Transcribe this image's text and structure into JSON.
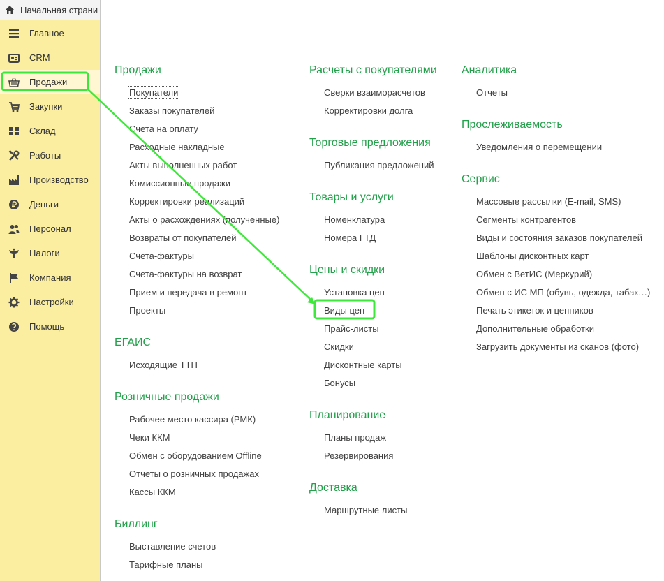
{
  "tab": {
    "title": "Начальная страни",
    "icon": "home-icon"
  },
  "sidebar": {
    "items": [
      {
        "label": "Главное",
        "icon": "menu-lines-icon"
      },
      {
        "label": "CRM",
        "icon": "address-card-icon"
      },
      {
        "label": "Продажи",
        "icon": "shopping-basket-icon"
      },
      {
        "label": "Закупки",
        "icon": "cart-icon"
      },
      {
        "label": "Склад",
        "icon": "warehouse-grid-icon"
      },
      {
        "label": "Работы",
        "icon": "tools-icon"
      },
      {
        "label": "Производство",
        "icon": "factory-icon"
      },
      {
        "label": "Деньги",
        "icon": "ruble-coin-icon"
      },
      {
        "label": "Персонал",
        "icon": "people-icon"
      },
      {
        "label": "Налоги",
        "icon": "eagle-icon"
      },
      {
        "label": "Компания",
        "icon": "flag-icon"
      },
      {
        "label": "Настройки",
        "icon": "gear-icon"
      },
      {
        "label": "Помощь",
        "icon": "question-icon"
      }
    ]
  },
  "columns": {
    "col1": [
      {
        "title": "Продажи",
        "items": [
          "Покупатели",
          "Заказы покупателей",
          "Счета на оплату",
          "Расходные накладные",
          "Акты выполненных работ",
          "Комиссионные продажи",
          "Корректировки реализаций",
          "Акты о расхождениях (полученные)",
          "Возвраты от покупателей",
          "Счета-фактуры",
          "Счета-фактуры на возврат",
          "Прием и передача в ремонт",
          "Проекты"
        ]
      },
      {
        "title": "ЕГАИС",
        "items": [
          "Исходящие ТТН"
        ]
      },
      {
        "title": "Розничные продажи",
        "items": [
          "Рабочее место кассира (РМК)",
          "Чеки ККМ",
          "Обмен с оборудованием Offline",
          "Отчеты о розничных продажах",
          "Кассы ККМ"
        ]
      },
      {
        "title": "Биллинг",
        "items": [
          "Выставление счетов",
          "Тарифные планы"
        ]
      }
    ],
    "col2": [
      {
        "title": "Расчеты с покупателями",
        "items": [
          "Сверки взаиморасчетов",
          "Корректировки долга"
        ]
      },
      {
        "title": "Торговые предложения",
        "items": [
          "Публикация предложений"
        ]
      },
      {
        "title": "Товары и услуги",
        "items": [
          "Номенклатура",
          "Номера ГТД"
        ]
      },
      {
        "title": "Цены и скидки",
        "items": [
          "Установка цен",
          "Виды цен",
          "Прайс-листы",
          "Скидки",
          "Дисконтные карты",
          "Бонусы"
        ]
      },
      {
        "title": "Планирование",
        "items": [
          "Планы продаж",
          "Резервирования"
        ]
      },
      {
        "title": "Доставка",
        "items": [
          "Маршрутные листы"
        ]
      }
    ],
    "col3": [
      {
        "title": "Аналитика",
        "items": [
          "Отчеты"
        ]
      },
      {
        "title": "Прослеживаемость",
        "items": [
          "Уведомления о перемещении"
        ]
      },
      {
        "title": "Сервис",
        "items": [
          "Массовые рассылки (E-mail, SMS)",
          "Сегменты контрагентов",
          "Виды и состояния заказов покупателей",
          "Шаблоны дисконтных карт",
          "Обмен с ВетИС (Меркурий)",
          "Обмен с ИС МП (обувь, одежда, табак…)",
          "Печать этикеток и ценников",
          "Дополнительные обработки",
          "Загрузить документы из сканов (фото)"
        ]
      }
    ]
  },
  "colors": {
    "section": "#22a04a",
    "sidebar_bg": "#fbeea0",
    "annotation": "#3ee83a"
  }
}
